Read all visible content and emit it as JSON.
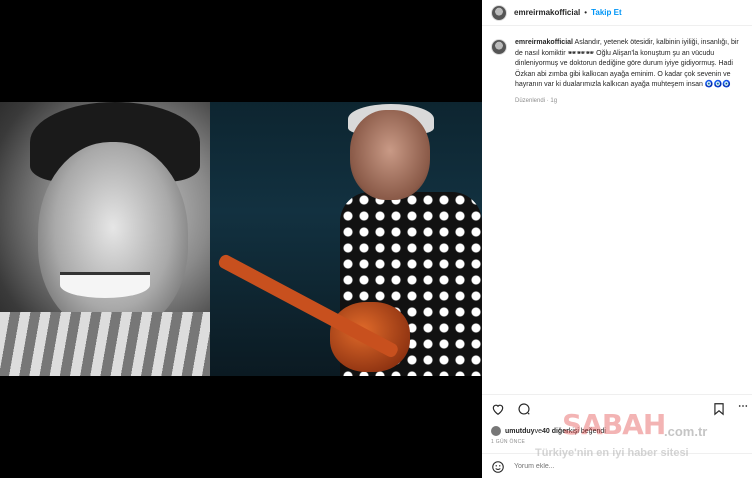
{
  "post": {
    "username": "emreirmakofficial",
    "follow_label": "Takip Et",
    "separator": "•"
  },
  "caption": {
    "username": "emreirmakofficial",
    "text": "Aslandır, yetenek ötesidir, kalbinin iyiliği, insanlığı, bir de nasıl komiktir 🕶🕶🕶 Oğlu Alişan'la konuştum şu an vücudu dinleniyormuş ve doktorun dediğine göre durum iyiye gidiyormuş. Hadi Özkan abi zımba gibi kalkıcan ayağa eminim. O kadar çok sevenin ve hayranın var ki dualarımızla kalkıcan ayağa muhteşem insan 🧿🧿🧿",
    "edited": "Düzenlendi · 1g"
  },
  "likes": {
    "liked_by": "umutduy",
    "rest": " ve ",
    "others": "40 diğer",
    "suffix": " kişi beğendi"
  },
  "time": "1 GÜN ÖNCE",
  "comment": {
    "placeholder": "Yorum ekle..."
  },
  "watermark": {
    "brand": "SABAH",
    "domain": ".com.tr",
    "tagline": "Türkiye'nin en iyi haber sitesi"
  },
  "icons": [
    "heart-icon",
    "comment-icon",
    "bookmark-icon",
    "more-icon",
    "emoji-icon"
  ]
}
